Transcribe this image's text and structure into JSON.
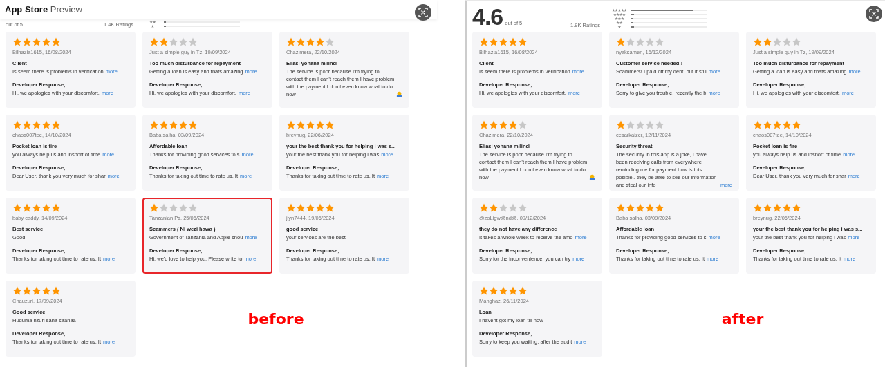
{
  "panels": [
    {
      "header": {
        "brand": "App Store",
        "suffix": "Preview"
      },
      "summary": {
        "out_of": "out of 5",
        "ratings": "1.4K Ratings"
      },
      "histogram": [
        {
          "label": "★★",
          "level": 0.03
        },
        {
          "label": "★",
          "level": 0.03
        }
      ],
      "reviews": [
        {
          "stars": 5,
          "author": "Bilhazia1615, 16/08/2024",
          "title": "Cliënt",
          "body": "Is seem there is problems in verification",
          "body_more": "more",
          "ends_with_icon": false,
          "response_label": "Developer Response,",
          "response": "Hi, we apologies with your discomfort.",
          "response_more": "more",
          "highlighted": false
        },
        {
          "stars": 2,
          "author": "Just a simple guy in Tz, 19/09/2024",
          "title": "Too much disturbance for repayment",
          "body": "Getting a loan is easy and thats amazing",
          "body_more": "more",
          "ends_with_icon": false,
          "response_label": "Developer Response,",
          "response": "Hi, we apologies with your discomfort.",
          "response_more": "more",
          "highlighted": false
        },
        {
          "stars": 4,
          "author": "Chazimera, 22/10/2024",
          "title": "Eliasi yohana milindi",
          "body": "The service is poor because I’m trying to contact them I can’t reach them I have problem with the payment I don’t even know what to do now",
          "ends_with_icon": true,
          "highlighted": false
        },
        {
          "stars": 5,
          "author": "chaos007tee, 14/10/2024",
          "title": "Pocket loan is fire",
          "body": "you always help us and inshort of time",
          "body_more": "more",
          "ends_with_icon": false,
          "response_label": "Developer Response,",
          "response": "Dear User, thank you very much for shar",
          "response_more": "more",
          "highlighted": false
        },
        {
          "stars": 5,
          "author": "Baba salha, 03/09/2024",
          "title": "Affordable loan",
          "body": "Thanks for providing good services to s",
          "body_more": "more",
          "ends_with_icon": false,
          "response_label": "Developer Response,",
          "response": "Thanks for taking out time to rate us. It",
          "response_more": "more",
          "highlighted": false
        },
        {
          "stars": 5,
          "author": "breynug, 22/06/2024",
          "title": "your the best thank you for helping i was s...",
          "body": "your the best thank you for helping i was",
          "body_more": "more",
          "ends_with_icon": false,
          "response_label": "Developer Response,",
          "response": "Thanks for taking out time to rate us. It",
          "response_more": "more",
          "highlighted": false
        },
        {
          "stars": 5,
          "author": "baby caddy, 14/09/2024",
          "title": "Best service",
          "body": "Good",
          "ends_with_icon": false,
          "response_label": "Developer Response,",
          "response": "Thanks for taking out time to rate us. It",
          "response_more": "more",
          "highlighted": false
        },
        {
          "stars": 1,
          "author": "Tanzanian Ps, 25/06/2024",
          "title": "Scammers ( Ni wezi hawa )",
          "body": "Government of Tanzania and Apple shou",
          "body_more": "more",
          "ends_with_icon": false,
          "response_label": "Developer Response,",
          "response": "Hi, we'd love to help you. Please write to",
          "response_more": "more",
          "highlighted": true
        },
        {
          "stars": 5,
          "author": "jlyn7444, 19/06/2024",
          "title": "good service",
          "body": "your services are the best",
          "ends_with_icon": false,
          "response_label": "Developer Response,",
          "response": "Thanks for taking out time to rate us. It",
          "response_more": "more",
          "highlighted": false
        },
        {
          "stars": 5,
          "author": "Chauzuri, 17/09/2024",
          "title": "Good service",
          "body": "Huduma nzuri sana saanaa",
          "ends_with_icon": false,
          "response_label": "Developer Response,",
          "response": "Thanks for taking out time to rate us. It",
          "response_more": "more",
          "highlighted": false
        }
      ],
      "caption": "before"
    },
    {
      "summary": {
        "score": "4.6",
        "out_of": "out of 5",
        "ratings": "1.9K Ratings"
      },
      "histogram": [
        {
          "label": "★★★★★",
          "level": 0.82
        },
        {
          "label": "★★★★",
          "level": 0.05
        },
        {
          "label": "★★★",
          "level": 0.03
        },
        {
          "label": "★★",
          "level": 0.03
        },
        {
          "label": "★",
          "level": 0.05
        }
      ],
      "reviews": [
        {
          "stars": 5,
          "author": "Bilhazia1615, 16/08/2024",
          "title": "Cliënt",
          "body": "Is seem there is problems in verification",
          "body_more": "more",
          "ends_with_icon": false,
          "response_label": "Developer Response,",
          "response": "Hi, we apologies with your discomfort.",
          "response_more": "more",
          "highlighted": false
        },
        {
          "stars": 1,
          "author": "nyaksamen, 16/12/2024",
          "title": "Customer service needed!!",
          "body": "Scammers! I paid off my debt, but it still",
          "body_more": "more",
          "ends_with_icon": false,
          "response_label": "Developer Response,",
          "response": "Sorry to give you trouble, recently the b",
          "response_more": "more",
          "highlighted": false
        },
        {
          "stars": 2,
          "author": "Just a simple guy in Tz, 19/09/2024",
          "title": "Too much disturbance for repayment",
          "body": "Getting a loan is easy and thats amazing",
          "body_more": "more",
          "ends_with_icon": false,
          "response_label": "Developer Response,",
          "response": "Hi, we apologies with your discomfort.",
          "response_more": "more",
          "highlighted": false
        },
        {
          "stars": 4,
          "author": "Chazimera, 22/10/2024",
          "title": "Eliasi yohana milindi",
          "body": "The service is poor because I’m trying to contact them I can’t reach them I have problem with the payment I don’t even know what to do now",
          "ends_with_icon": true,
          "highlighted": false
        },
        {
          "stars": 1,
          "author": "cesarkaizer, 12/11/2024",
          "title": "Security threat",
          "body": "The security in this app is a joke, i have been receiving calls from everywhere reminding me for payment how is this posible.. they be able to see our information and steal our info",
          "body_more": "more",
          "ends_with_icon": false,
          "highlighted": false
        },
        {
          "stars": 5,
          "author": "chaos007tee, 14/10/2024",
          "title": "Pocket loan is fire",
          "body": "you always help us and inshort of time",
          "body_more": "more",
          "ends_with_icon": false,
          "response_label": "Developer Response,",
          "response": "Dear User, thank you very much for shar",
          "response_more": "more",
          "highlighted": false
        },
        {
          "stars": 2,
          "author": "@zoLigw@nd@, 09/12/2024",
          "title": "they do not have any difference",
          "body": "It takes a whole week to receive the amo",
          "body_more": "more",
          "ends_with_icon": false,
          "response_label": "Developer Response,",
          "response": "Sorry for the inconvenience, you can try",
          "response_more": "more",
          "highlighted": false
        },
        {
          "stars": 5,
          "author": "Baba salha, 03/09/2024",
          "title": "Affordable loan",
          "body": "Thanks for providing good services to s",
          "body_more": "more",
          "ends_with_icon": false,
          "response_label": "Developer Response,",
          "response": "Thanks for taking out time to rate us. It",
          "response_more": "more",
          "highlighted": false
        },
        {
          "stars": 5,
          "author": "breynug, 22/06/2024",
          "title": "your the best thank you for helping i was s...",
          "body": "your the best thank you for helping i was",
          "body_more": "more",
          "ends_with_icon": false,
          "response_label": "Developer Response,",
          "response": "Thanks for taking out time to rate us. It",
          "response_more": "more",
          "highlighted": false
        },
        {
          "stars": 5,
          "author": "Manghaz, 26/11/2024",
          "title": "Loan",
          "body": "I havent got my loan till now",
          "ends_with_icon": false,
          "response_label": "Developer Response,",
          "response": "Sorry to keep you waiting, after the audit",
          "response_more": "more",
          "highlighted": false
        }
      ],
      "caption": "after"
    }
  ]
}
